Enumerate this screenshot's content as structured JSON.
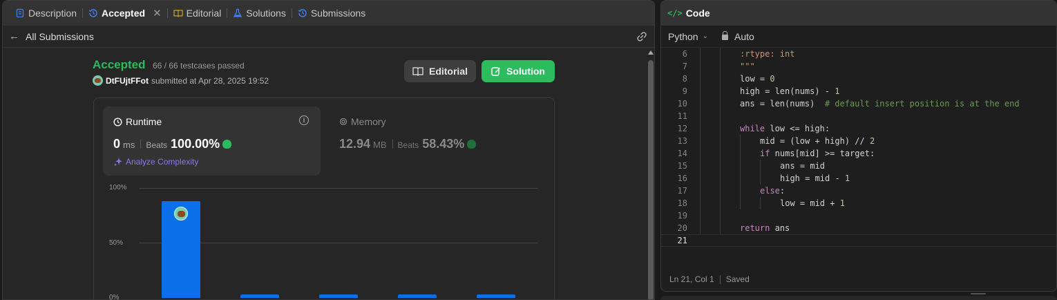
{
  "tabs": [
    {
      "label": "Description",
      "icon": "description-icon"
    },
    {
      "label": "Accepted",
      "icon": "history-icon",
      "active": true
    },
    {
      "label": "Editorial",
      "icon": "book-icon"
    },
    {
      "label": "Solutions",
      "icon": "flask-icon"
    },
    {
      "label": "Submissions",
      "icon": "history-icon"
    }
  ],
  "subbar": {
    "back_label": "All Submissions"
  },
  "submission": {
    "status": "Accepted",
    "testcases": "66 / 66 testcases passed",
    "user": "DtFUjtFFot",
    "submitted": "submitted at Apr 28, 2025 19:52"
  },
  "buttons": {
    "editorial": "Editorial",
    "solution": "Solution"
  },
  "runtime": {
    "title": "Runtime",
    "value": "0",
    "unit": "ms",
    "beats_label": "Beats",
    "beats": "100.00%",
    "analyze": "Analyze Complexity"
  },
  "memory": {
    "title": "Memory",
    "value": "12.94",
    "unit": "MB",
    "beats_label": "Beats",
    "beats": "58.43%"
  },
  "chart_data": {
    "type": "bar",
    "ytick_labels": [
      "100%",
      "50%",
      "0%"
    ],
    "ylim": [
      0,
      100
    ],
    "values": [
      88,
      3,
      3,
      3,
      3
    ],
    "highlight_index": 0,
    "color": "#0a6fe8"
  },
  "editor": {
    "title": "Code",
    "language": "Python",
    "mode": "Auto",
    "lines": [
      {
        "n": "6",
        "indent": 2,
        "text": ":rtype: int"
      },
      {
        "n": "7",
        "indent": 2,
        "text": "\"\"\""
      },
      {
        "n": "8",
        "indent": 2,
        "text": "low = 0"
      },
      {
        "n": "9",
        "indent": 2,
        "text": "high = len(nums) - 1"
      },
      {
        "n": "10",
        "indent": 2,
        "text": "ans = len(nums)  # default insert position is at the end"
      },
      {
        "n": "11",
        "indent": 2,
        "text": ""
      },
      {
        "n": "12",
        "indent": 2,
        "text": "while low <= high:"
      },
      {
        "n": "13",
        "indent": 3,
        "text": "mid = (low + high) // 2"
      },
      {
        "n": "14",
        "indent": 3,
        "text": "if nums[mid] >= target:"
      },
      {
        "n": "15",
        "indent": 4,
        "text": "ans = mid"
      },
      {
        "n": "16",
        "indent": 4,
        "text": "high = mid - 1"
      },
      {
        "n": "17",
        "indent": 3,
        "text": "else:"
      },
      {
        "n": "18",
        "indent": 4,
        "text": "low = mid + 1"
      },
      {
        "n": "19",
        "indent": 2,
        "text": ""
      },
      {
        "n": "20",
        "indent": 2,
        "text": "return ans"
      },
      {
        "n": "21",
        "indent": 0,
        "text": "",
        "current": true
      }
    ],
    "cursor": "Ln 21, Col 1",
    "save_state": "Saved"
  },
  "colors": {
    "accepted": "#2cbb5d",
    "keyword": "#c586c0",
    "docstring": "#ce9178",
    "number": "#b5cea8",
    "comment": "#6a9955",
    "bar": "#0a6fe8"
  }
}
